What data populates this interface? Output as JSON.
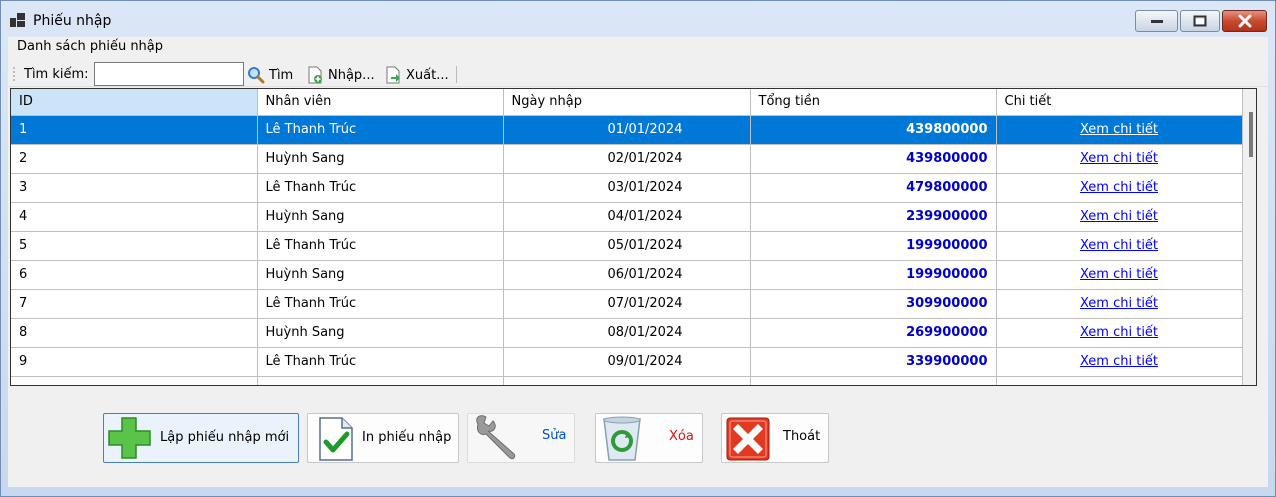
{
  "window": {
    "title": "Phiếu nhập"
  },
  "group": {
    "label": "Danh sách phiếu nhập"
  },
  "toolbar": {
    "search_label": "Tìm kiếm:",
    "search_value": "",
    "find_label": "Tìm",
    "import_label": "Nhập...",
    "export_label": "Xuất..."
  },
  "grid": {
    "columns": [
      "ID",
      "Nhân viên",
      "Ngày nhập",
      "Tổng tiền",
      "Chi tiết"
    ],
    "rows": [
      {
        "id": "1",
        "employee": "Lê Thanh Trúc",
        "date": "01/01/2024",
        "total": "439800000",
        "detail": "Xem chi tiết"
      },
      {
        "id": "2",
        "employee": "Huỳnh Sang",
        "date": "02/01/2024",
        "total": "439800000",
        "detail": "Xem chi tiết"
      },
      {
        "id": "3",
        "employee": "Lê Thanh Trúc",
        "date": "03/01/2024",
        "total": "479800000",
        "detail": "Xem chi tiết"
      },
      {
        "id": "4",
        "employee": "Huỳnh Sang",
        "date": "04/01/2024",
        "total": "239900000",
        "detail": "Xem chi tiết"
      },
      {
        "id": "5",
        "employee": "Lê Thanh Trúc",
        "date": "05/01/2024",
        "total": "199900000",
        "detail": "Xem chi tiết"
      },
      {
        "id": "6",
        "employee": "Huỳnh Sang",
        "date": "06/01/2024",
        "total": "199900000",
        "detail": "Xem chi tiết"
      },
      {
        "id": "7",
        "employee": "Lê Thanh Trúc",
        "date": "07/01/2024",
        "total": "309900000",
        "detail": "Xem chi tiết"
      },
      {
        "id": "8",
        "employee": "Huỳnh Sang",
        "date": "08/01/2024",
        "total": "269900000",
        "detail": "Xem chi tiết"
      },
      {
        "id": "9",
        "employee": "Lê Thanh Trúc",
        "date": "09/01/2024",
        "total": "339900000",
        "detail": "Xem chi tiết"
      },
      {
        "id": "",
        "employee": "",
        "date": "",
        "total": "",
        "detail": ""
      }
    ]
  },
  "buttons": {
    "create": "Lập phiếu nhập mới",
    "print": "In phiếu nhập",
    "edit": "Sửa",
    "delete": "Xóa",
    "exit": "Thoát"
  },
  "colors": {
    "selection": "#0078d7",
    "total_text": "#0000cc",
    "link_text": "#0000ff",
    "edit_text": "#0050c8",
    "delete_text": "#e01010"
  },
  "icons": {
    "create": "plus-icon",
    "print": "document-check-icon",
    "edit": "wrench-icon",
    "delete": "recycle-bin-icon",
    "exit": "close-x-icon"
  }
}
